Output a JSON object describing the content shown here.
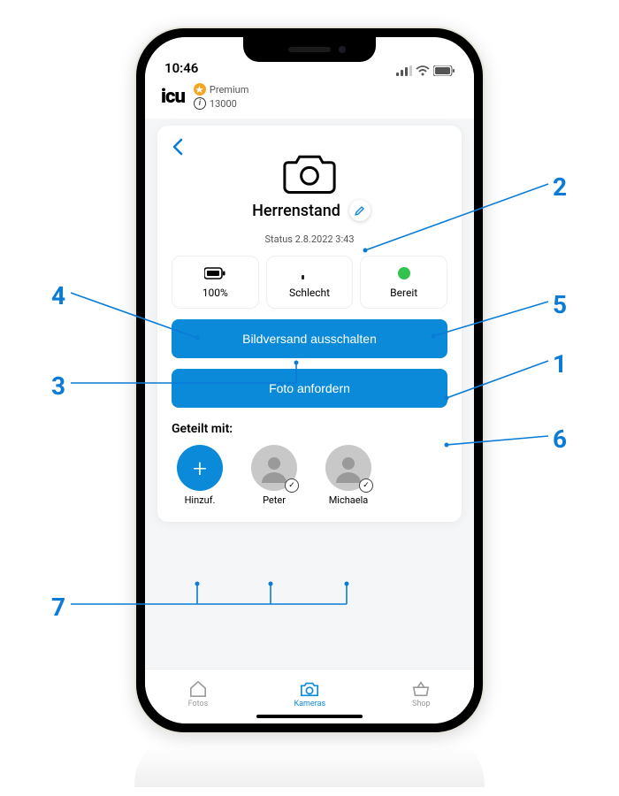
{
  "statusbar": {
    "time": "10:46"
  },
  "header": {
    "logo": "icu",
    "tier_label": "Premium",
    "credits": "13000"
  },
  "camera": {
    "name": "Herrenstand",
    "status_line": "Status 2.8.2022 3:43",
    "stats": {
      "battery": "100%",
      "signal": "Schlecht",
      "ready": "Bereit"
    },
    "btn_disable": "Bildversand ausschalten",
    "btn_request": "Foto anfordern"
  },
  "share": {
    "title": "Geteilt mit:",
    "add_label": "Hinzuf.",
    "users": [
      {
        "name": "Peter"
      },
      {
        "name": "Michaela"
      }
    ]
  },
  "nav": {
    "photos": "Fotos",
    "cameras": "Kameras",
    "shop": "Shop"
  },
  "annotations": {
    "n1": "1",
    "n2": "2",
    "n3": "3",
    "n4": "4",
    "n5": "5",
    "n6": "6",
    "n7": "7"
  }
}
